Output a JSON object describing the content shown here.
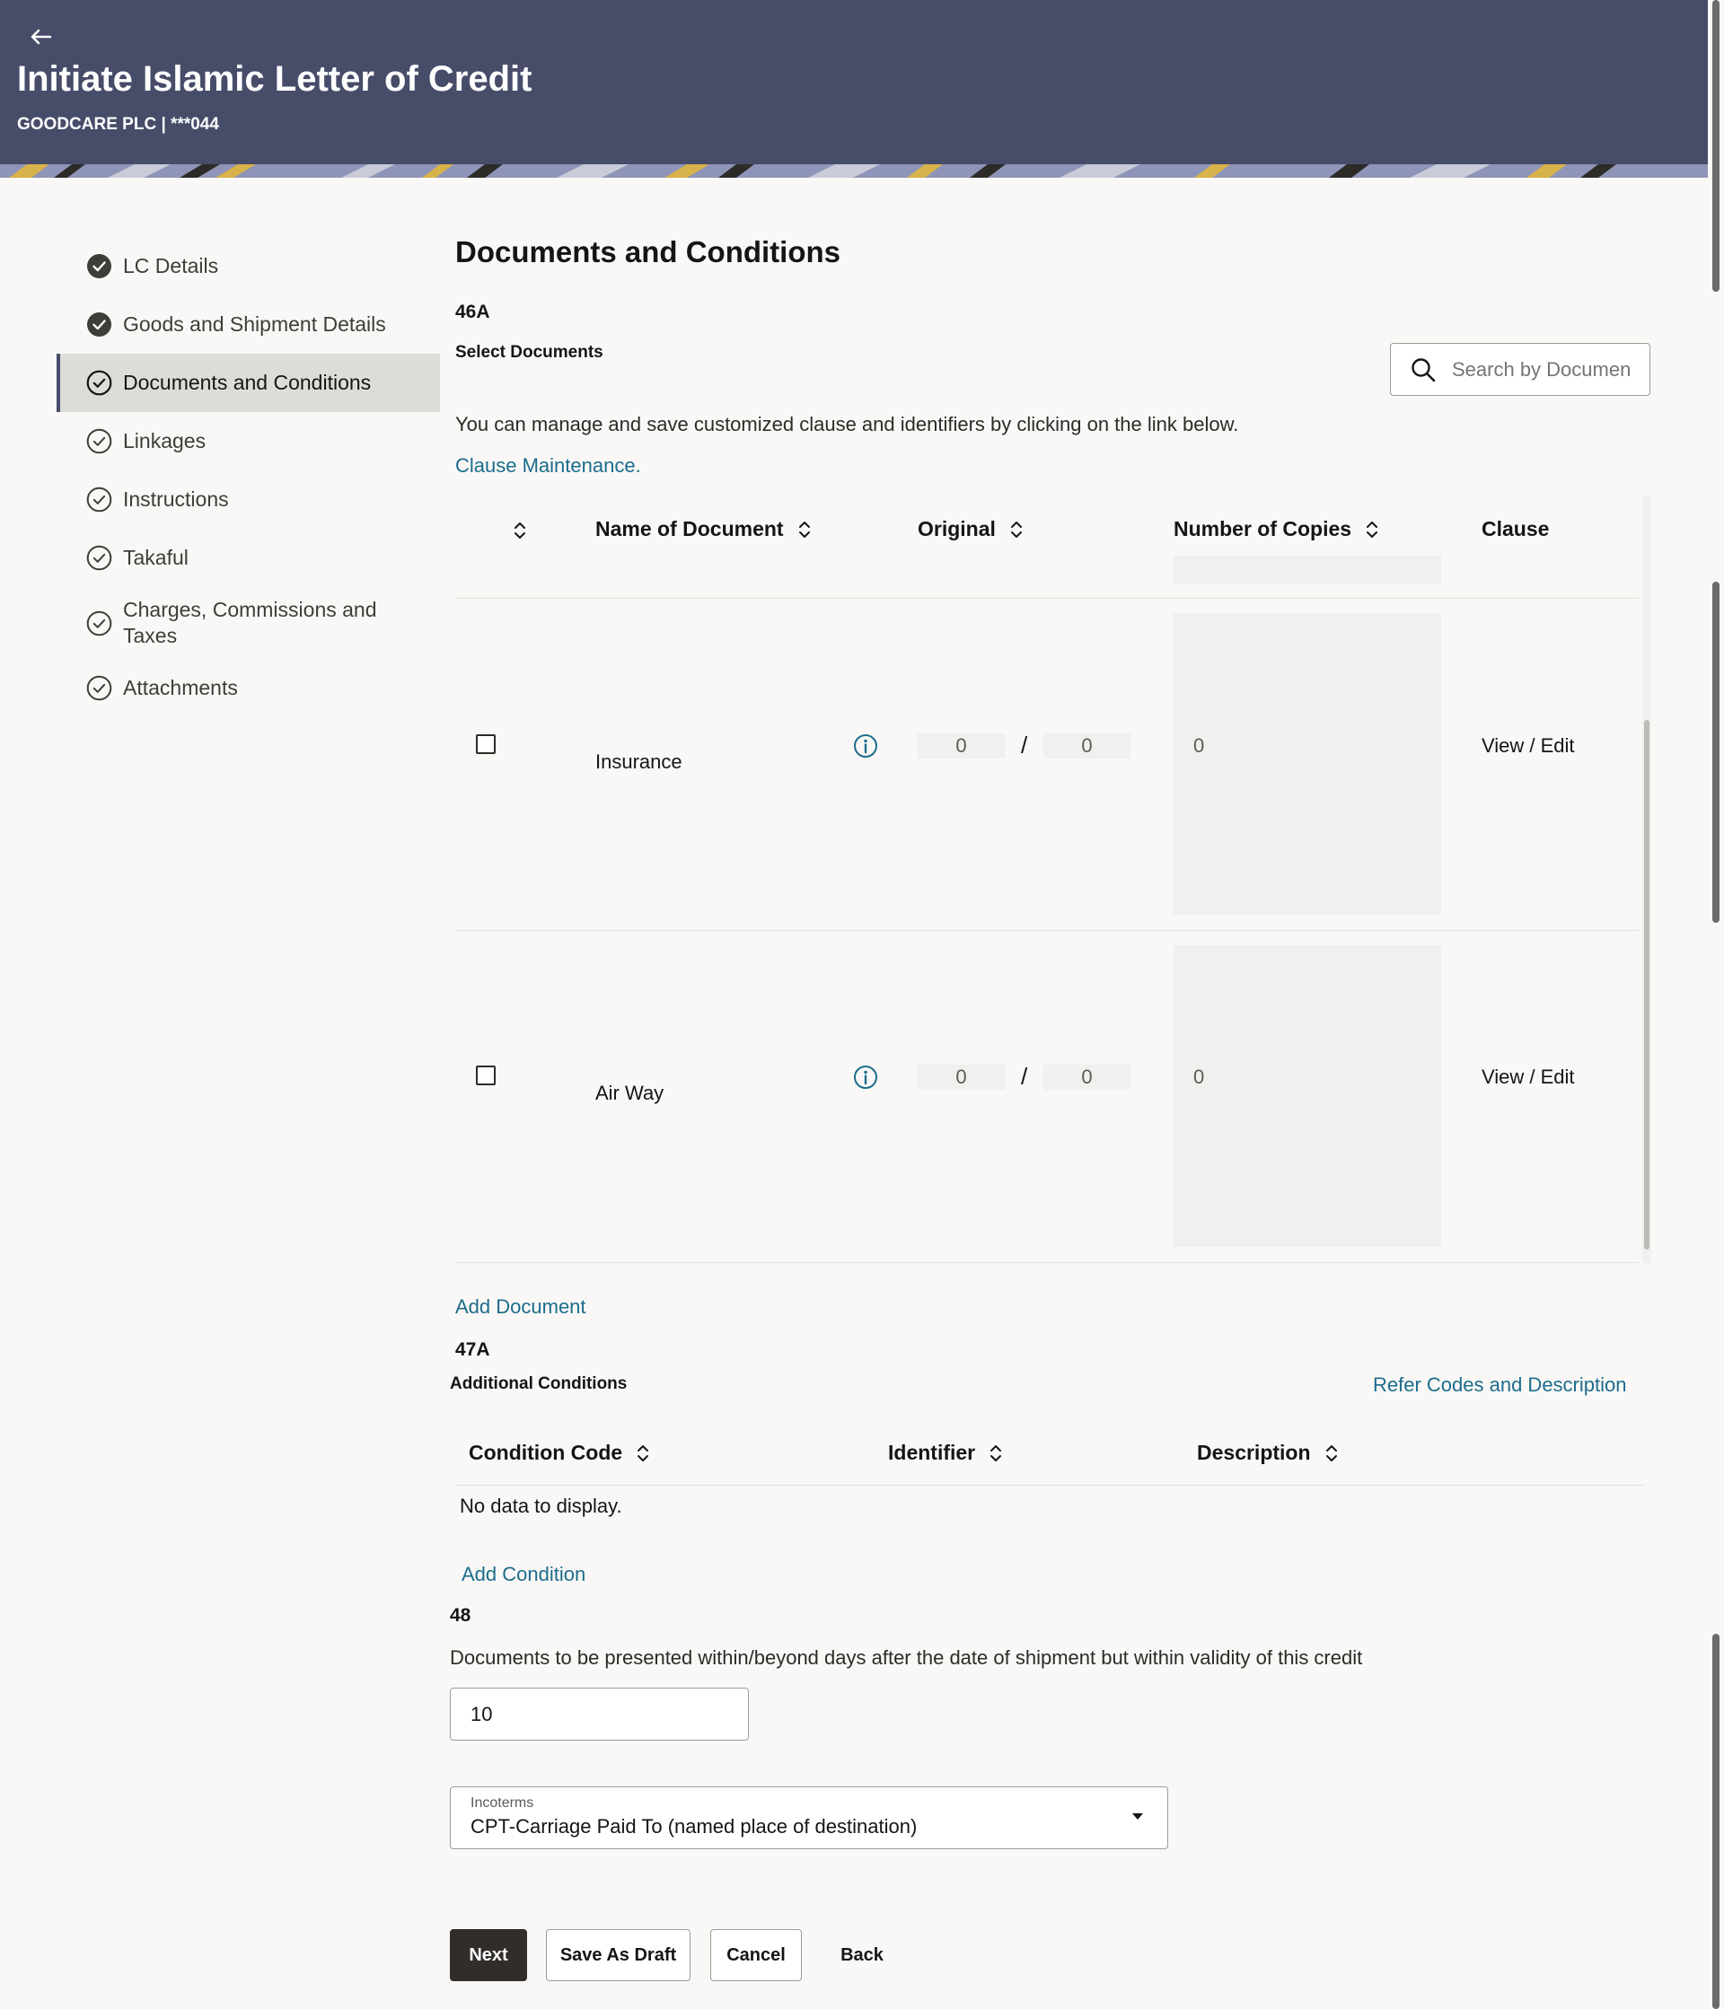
{
  "header": {
    "title": "Initiate Islamic Letter of Credit",
    "subtitle": "GOODCARE PLC | ***044"
  },
  "nav": {
    "items": [
      {
        "label": "LC Details",
        "status": "completed"
      },
      {
        "label": "Goods and Shipment Details",
        "status": "completed"
      },
      {
        "label": "Documents and Conditions",
        "status": "current"
      },
      {
        "label": "Linkages",
        "status": "pending"
      },
      {
        "label": "Instructions",
        "status": "pending"
      },
      {
        "label": "Takaful",
        "status": "pending"
      },
      {
        "label": "Charges, Commissions and Taxes",
        "status": "pending"
      },
      {
        "label": "Attachments",
        "status": "pending"
      }
    ]
  },
  "main": {
    "section_title": "Documents and Conditions",
    "code_46a": "46A",
    "select_documents": "Select Documents",
    "search": {
      "placeholder": "Search by Document"
    },
    "manage_text": "You can manage and save customized clause and identifiers by clicking on the link below.",
    "clause_maintenance": "Clause Maintenance.",
    "documents_table": {
      "columns": [
        "Name of Document",
        "Original",
        "Number of Copies",
        "Clause"
      ],
      "rows": [
        {
          "name": "Insurance",
          "original_a": "0",
          "original_sep": "/",
          "original_b": "0",
          "copies": "0",
          "clause": "View / Edit"
        },
        {
          "name": "Air Way",
          "original_a": "0",
          "original_sep": "/",
          "original_b": "0",
          "copies": "0",
          "clause": "View / Edit"
        }
      ]
    },
    "add_document": "Add Document",
    "code_47a": "47A",
    "additional_conditions": "Additional Conditions",
    "refer_codes": "Refer Codes and Description",
    "conditions_table": {
      "columns": [
        "Condition Code",
        "Identifier",
        "Description"
      ],
      "empty_text": "No data to display."
    },
    "add_condition": "Add Condition",
    "code_48": "48",
    "docs_presented_text": "Documents to be presented within/beyond days after the date of shipment but within validity of this credit",
    "days_value": "10",
    "incoterms": {
      "label": "Incoterms",
      "value": "CPT-Carriage Paid To (named place of destination)"
    }
  },
  "actions": {
    "next": "Next",
    "save_draft": "Save As Draft",
    "cancel": "Cancel",
    "back": "Back"
  },
  "colors": {
    "header_bg": "#474c69",
    "link": "#1c6c8c",
    "primary_button": "#312d2a",
    "active_nav_bg": "#dedcd9"
  }
}
